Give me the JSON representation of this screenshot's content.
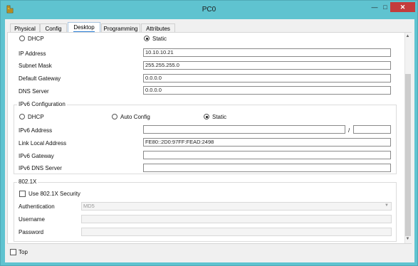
{
  "window": {
    "title": "PC0",
    "icon": "packet-tracer-icon",
    "buttons": {
      "minimize": "—",
      "maximize": "□",
      "close": "✕"
    }
  },
  "tabs": [
    {
      "label": "Physical"
    },
    {
      "label": "Config"
    },
    {
      "label": "Desktop",
      "active": true
    },
    {
      "label": "Programming"
    },
    {
      "label": "Attributes"
    }
  ],
  "ipv4": {
    "dhcp_label": "DHCP",
    "static_label": "Static",
    "mode": "Static",
    "fields": {
      "ip_address": {
        "label": "IP Address",
        "value": "10.10.10.21"
      },
      "subnet_mask": {
        "label": "Subnet Mask",
        "value": "255.255.255.0"
      },
      "default_gateway": {
        "label": "Default Gateway",
        "value": "0.0.0.0"
      },
      "dns_server": {
        "label": "DNS Server",
        "value": "0.0.0.0"
      }
    }
  },
  "ipv6": {
    "group_title": "IPv6 Configuration",
    "dhcp_label": "DHCP",
    "auto_label": "Auto Config",
    "static_label": "Static",
    "mode": "Static",
    "fields": {
      "ipv6_address": {
        "label": "IPv6 Address",
        "value": "",
        "prefix": ""
      },
      "prefix_sep": "/",
      "link_local": {
        "label": "Link Local Address",
        "value": "FE80::2D0:97FF:FEAD:2498"
      },
      "ipv6_gateway": {
        "label": "IPv6 Gateway",
        "value": ""
      },
      "ipv6_dns": {
        "label": "IPv6 DNS Server",
        "value": ""
      }
    }
  },
  "dot1x": {
    "group_title": "802.1X",
    "use_security_label": "Use 802.1X Security",
    "use_security_checked": false,
    "authentication": {
      "label": "Authentication",
      "value": "MD5"
    },
    "username": {
      "label": "Username",
      "value": ""
    },
    "password": {
      "label": "Password",
      "value": ""
    }
  },
  "footer": {
    "top_label": "Top",
    "top_checked": false
  },
  "colors": {
    "titlebar": "#5fc3d0",
    "close_button": "#c43c3c",
    "active_tab_underline": "#2a7ed6"
  }
}
